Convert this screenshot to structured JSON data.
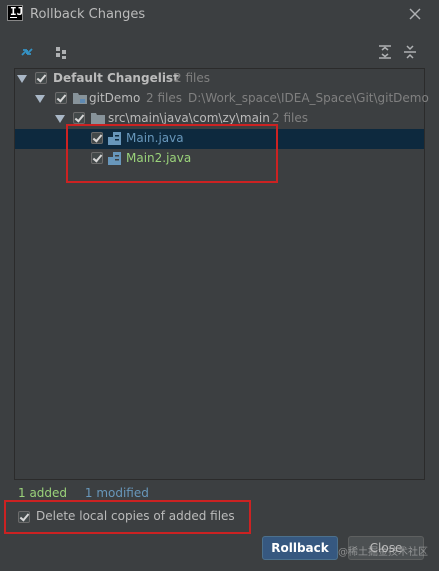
{
  "window": {
    "title": "Rollback Changes",
    "app_icon_letter": "IJ"
  },
  "toolbar": {
    "buttons": [
      {
        "name": "show-diff-icon"
      },
      {
        "name": "group-by-icon"
      },
      {
        "name": "expand-all-icon"
      },
      {
        "name": "collapse-all-icon"
      }
    ]
  },
  "tree": {
    "changelist": {
      "label": "Default Changelist",
      "count": "2 files"
    },
    "module": {
      "label": "gitDemo",
      "count": "2 files",
      "path": "D:\\Work_space\\IDEA_Space\\Git\\gitDemo"
    },
    "package": {
      "label": "src\\main\\java\\com\\zy\\main",
      "count": "2 files"
    },
    "files": [
      {
        "label": "Main.java",
        "color": "#6897bb"
      },
      {
        "label": "Main2.java",
        "color": "#9ad27a"
      }
    ]
  },
  "status": {
    "added": "1 added",
    "modified": "1 modified"
  },
  "options": {
    "delete_local_copies_label": "Delete local copies of added files"
  },
  "buttons": {
    "rollback": "Rollback",
    "close": "Close"
  },
  "watermark": "@稀土掘金技术社区",
  "colors": {
    "background": "#3c3f41",
    "selection": "#0d293e",
    "highlight_box": "#cc2222",
    "primary_button": "#365880"
  }
}
